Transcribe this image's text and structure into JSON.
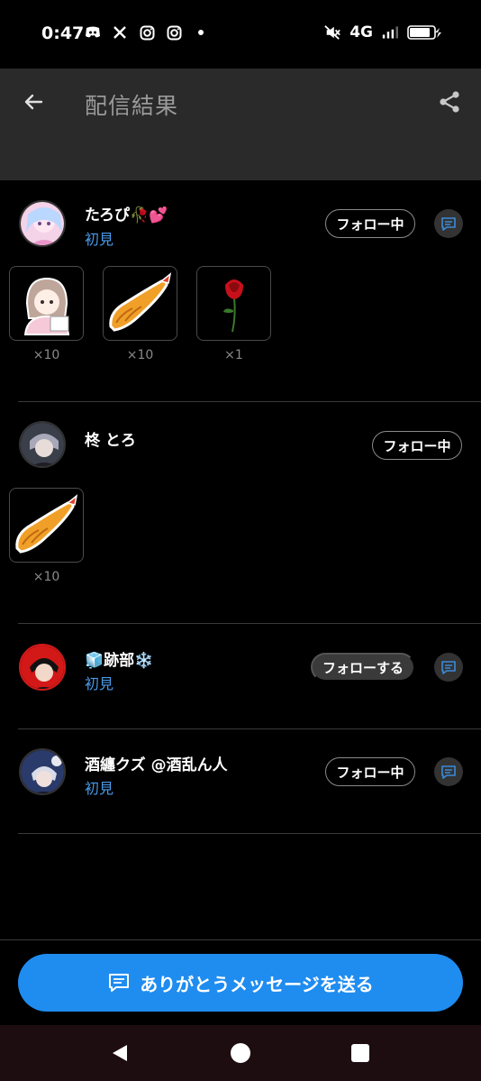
{
  "status_bar": {
    "time": "0:47",
    "network": "4G",
    "left_icons": [
      "discord-icon",
      "x-icon",
      "instagram-icon",
      "instagram-icon",
      "dot-icon"
    ],
    "right_icons": [
      "mute-icon",
      "signal-icon",
      "battery-charging-icon"
    ]
  },
  "app_bar": {
    "title": "配信結果",
    "back_icon": "arrow-left-icon",
    "share_icon": "share-icon"
  },
  "entries": [
    {
      "name": "たろぴ🥀💕",
      "sub": "初見",
      "follow_label": "フォロー中",
      "gifts": [
        {
          "item": "anime-girl-sticker",
          "count": "×10"
        },
        {
          "item": "fried-shrimp",
          "count": "×10"
        },
        {
          "item": "red-rose",
          "count": "×1"
        }
      ]
    },
    {
      "name": "柊 とろ",
      "sub": "",
      "follow_label": "フォロー中",
      "gifts": [
        {
          "item": "fried-shrimp",
          "count": "×10"
        }
      ]
    },
    {
      "name": "🧊跡部❄️",
      "sub": "初見",
      "follow_label": "フォローする",
      "gifts": []
    },
    {
      "name": "酒纏クズ @酒乱ん人",
      "sub": "初見",
      "follow_label": "フォロー中",
      "gifts": []
    }
  ],
  "cta": {
    "label": "ありがとうメッセージを送る",
    "icon": "message-icon"
  },
  "nav": {
    "back_icon": "triangle-back-icon",
    "home_icon": "circle-home-icon",
    "recents_icon": "square-recents-icon"
  },
  "colors": {
    "accent": "#1f8cf0",
    "sub_text": "#4a9ae8",
    "app_bar": "#2a2a2a",
    "background": "#000000"
  }
}
